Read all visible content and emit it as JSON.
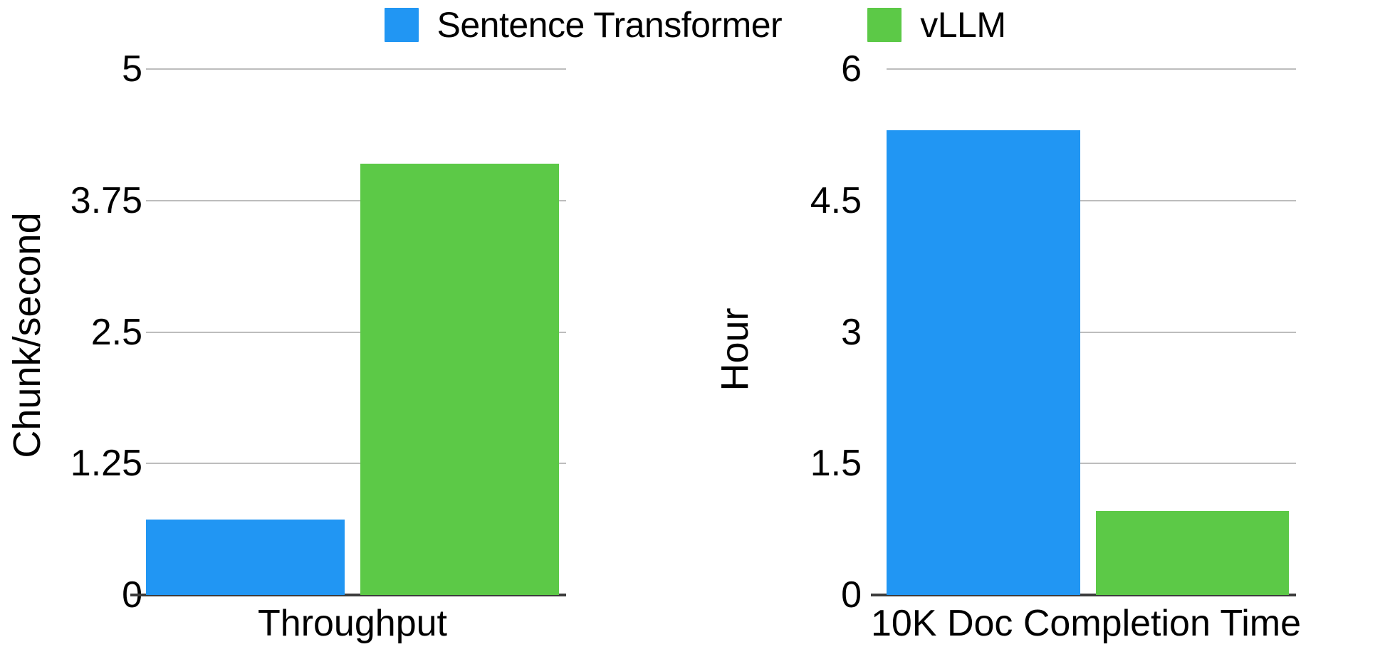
{
  "legend": {
    "position": "top-center",
    "items": [
      {
        "label": "Sentence Transformer",
        "color": "#2196f3",
        "swatch_name": "legend-swatch-sentence-transformer"
      },
      {
        "label": "vLLM",
        "color": "#5cc947",
        "swatch_name": "legend-swatch-vllm"
      }
    ]
  },
  "colors": {
    "sentence_transformer": "#2196f3",
    "vllm": "#5cc947",
    "gridline": "#bdbdbd",
    "axis": "#3c3c3c",
    "background": "#ffffff",
    "text": "#000000"
  },
  "chart_data": [
    {
      "type": "bar",
      "id": "throughput",
      "title": "",
      "xlabel": "",
      "ylabel": "Chunk/second",
      "categories": [
        "Throughput"
      ],
      "ylim": [
        0,
        5
      ],
      "yticks": [
        "5",
        "3.75",
        "2.5",
        "1.25",
        "0"
      ],
      "ytick_values": [
        5,
        3.75,
        2.5,
        1.25,
        0
      ],
      "grid": true,
      "legend_position": "top-center",
      "series": [
        {
          "name": "Sentence Transformer",
          "color": "#2196f3",
          "values": [
            0.72
          ]
        },
        {
          "name": "vLLM",
          "color": "#5cc947",
          "values": [
            4.1
          ]
        }
      ]
    },
    {
      "type": "bar",
      "id": "completion-time",
      "title": "",
      "xlabel": "",
      "ylabel": "Hour",
      "categories": [
        "10K Doc Completion Time"
      ],
      "ylim": [
        0,
        6
      ],
      "yticks": [
        "6",
        "4.5",
        "3",
        "1.5",
        "0"
      ],
      "ytick_values": [
        6,
        4.5,
        3,
        1.5,
        0
      ],
      "grid": true,
      "legend_position": "top-center",
      "series": [
        {
          "name": "Sentence Transformer",
          "color": "#2196f3",
          "values": [
            5.3
          ]
        },
        {
          "name": "vLLM",
          "color": "#5cc947",
          "values": [
            0.96
          ]
        }
      ]
    }
  ]
}
